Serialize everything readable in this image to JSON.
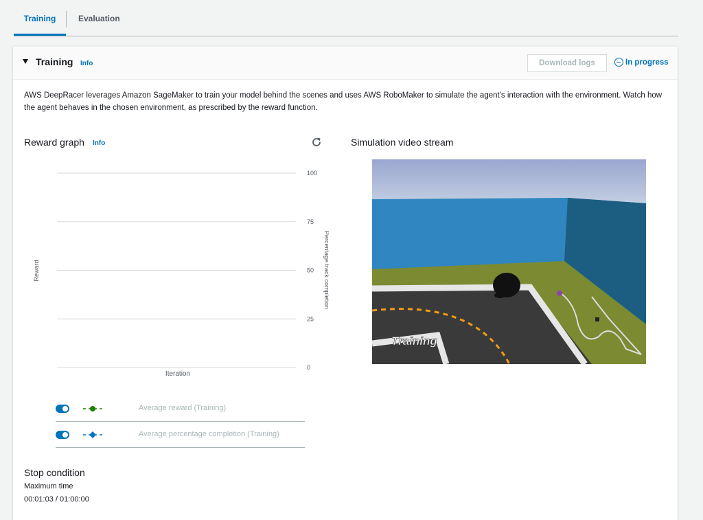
{
  "tabs": [
    {
      "label": "Training",
      "active": true
    },
    {
      "label": "Evaluation",
      "active": false
    }
  ],
  "panel": {
    "title": "Training",
    "info": "Info",
    "download_label": "Download logs",
    "status": "In progress",
    "description": "AWS DeepRacer leverages Amazon SageMaker to train your model behind the scenes and uses AWS RoboMaker to simulate the agent's interaction with the environment. Watch how the agent behaves in the chosen environment, as prescribed by the reward function."
  },
  "reward_graph": {
    "title": "Reward graph",
    "info": "Info",
    "refresh_icon": "refresh-icon"
  },
  "chart_data": {
    "type": "line",
    "xlabel": "Iteration",
    "ylabel": "Reward",
    "y2label": "Percentage track completion",
    "y2ticks": [
      "100",
      "75",
      "50",
      "25",
      "0"
    ],
    "y2lim": [
      0,
      100
    ],
    "grid": true,
    "series": [
      {
        "name": "Average reward (Training)",
        "values": [],
        "color": "#1d8102",
        "marker": "circle",
        "enabled": true
      },
      {
        "name": "Average percentage completion (Training)",
        "values": [],
        "color": "#0073bb",
        "marker": "diamond",
        "enabled": true
      }
    ]
  },
  "simulation": {
    "title": "Simulation video stream",
    "overlay_text": "Training"
  },
  "stop_condition": {
    "title": "Stop condition",
    "label": "Maximum time",
    "value": "00:01:03 / 01:00:00"
  },
  "colors": {
    "accent": "#0073bb",
    "reward_series": "#1d8102",
    "completion_series": "#0073bb"
  }
}
